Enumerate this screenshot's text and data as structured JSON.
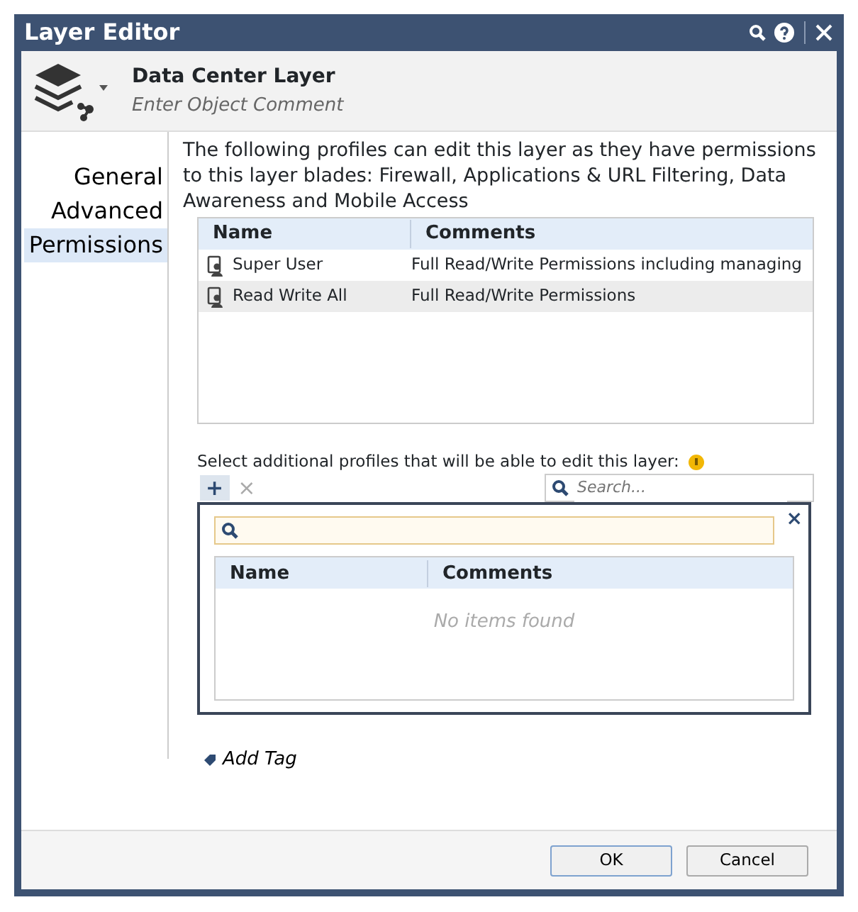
{
  "window": {
    "title": "Layer Editor"
  },
  "object": {
    "name": "Data Center Layer",
    "comment_placeholder": "Enter Object Comment"
  },
  "sidebar": {
    "items": [
      {
        "label": "General",
        "selected": false
      },
      {
        "label": "Advanced",
        "selected": false
      },
      {
        "label": "Permissions",
        "selected": true
      }
    ]
  },
  "description": "The following profiles can edit this layer as they have permissions to this layer blades: Firewall, Applications & URL Filtering, Data Awareness and Mobile Access",
  "profiles_table": {
    "columns": [
      "Name",
      "Comments"
    ],
    "rows": [
      {
        "name": "Super User",
        "comments": "Full Read/Write Permissions including managing",
        "selected": false
      },
      {
        "name": "Read Write All",
        "comments": "Full Read/Write Permissions",
        "selected": true
      }
    ]
  },
  "additional_label": "Select additional profiles that will be able to edit this layer:",
  "toolbar": {
    "add": "+",
    "remove": "×",
    "search_placeholder": "Search..."
  },
  "popup": {
    "close": "×",
    "columns": [
      "Name",
      "Comments"
    ],
    "empty": "No items found"
  },
  "add_tag": "Add Tag",
  "buttons": [
    "OK",
    "Cancel"
  ]
}
